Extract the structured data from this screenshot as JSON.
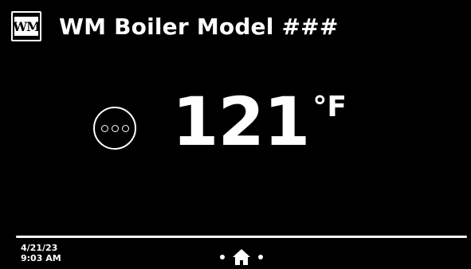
{
  "header": {
    "logo_text": "WM",
    "title": "WM Boiler Model ###"
  },
  "main": {
    "temperature_value": "121",
    "temperature_unit": "°F",
    "more_button_icon": "ellipsis-circle-icon"
  },
  "footer": {
    "date": "4/21/23",
    "time": "9:03 AM",
    "home_icon": "home-icon"
  },
  "colors": {
    "background": "#000000",
    "foreground": "#ffffff"
  }
}
